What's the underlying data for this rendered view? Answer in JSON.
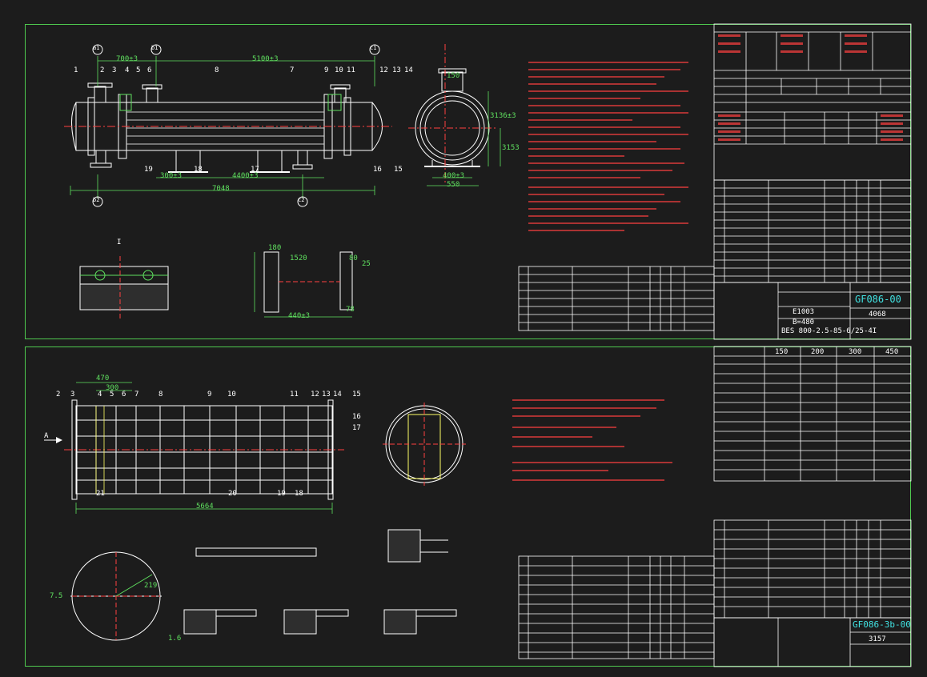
{
  "sheet1": {
    "drawing_number": "GF086-00",
    "model": "BES 800-2.5-85-6/25-4I",
    "size_label": "E1003",
    "length_label": "B=480",
    "weight": "4068",
    "dim_top_left": "700±3",
    "dim_top_mid": "5100±3",
    "dim_bottom_a": "300±3",
    "dim_bottom_b": "4400±3",
    "dim_total": "7048",
    "dim_side_top": "150",
    "dim_side_a": "400±3",
    "dim_side_b": "550",
    "dim_right_a": "3136±3",
    "dim_right_b": "3153",
    "section_title": "I",
    "detail_dim_a": "180",
    "detail_dim_b": "1520",
    "detail_dim_c": "80",
    "detail_dim_d": "25",
    "detail_dim_e": "440±3",
    "detail_dim_f": "78",
    "part_numbers_top": [
      "1",
      "2",
      "3",
      "4",
      "5",
      "6",
      "7",
      "8",
      "9",
      "10",
      "11",
      "12",
      "13",
      "14"
    ],
    "part_numbers_bottom": [
      "19",
      "18",
      "17",
      "16",
      "15"
    ],
    "nozzle_labels": [
      "a1",
      "b1",
      "c1",
      "b2",
      "c2"
    ]
  },
  "sheet2": {
    "drawing_number": "GF086-3b-00",
    "weight": "3157",
    "dim_a": "470",
    "dim_b": "300",
    "dim_total": "5664",
    "dim_c": "219",
    "dim_d": "7.5",
    "dim_e": "1.6",
    "section_label": "A",
    "part_numbers_top": [
      "2",
      "3",
      "4",
      "5",
      "6",
      "7",
      "8",
      "9",
      "10",
      "11",
      "12",
      "13",
      "14",
      "15"
    ],
    "part_numbers_bottom": [
      "21",
      "20",
      "19",
      "18",
      "17",
      "16"
    ],
    "spec_headers": [
      "150",
      "200",
      "300",
      "450"
    ]
  },
  "colors": {
    "background": "#1c1c1c",
    "border": "#4fc94f",
    "line": "#ffffff",
    "dim": "#5fe05f",
    "text_red": "#ff4040",
    "text_cyan": "#41e2e2"
  }
}
